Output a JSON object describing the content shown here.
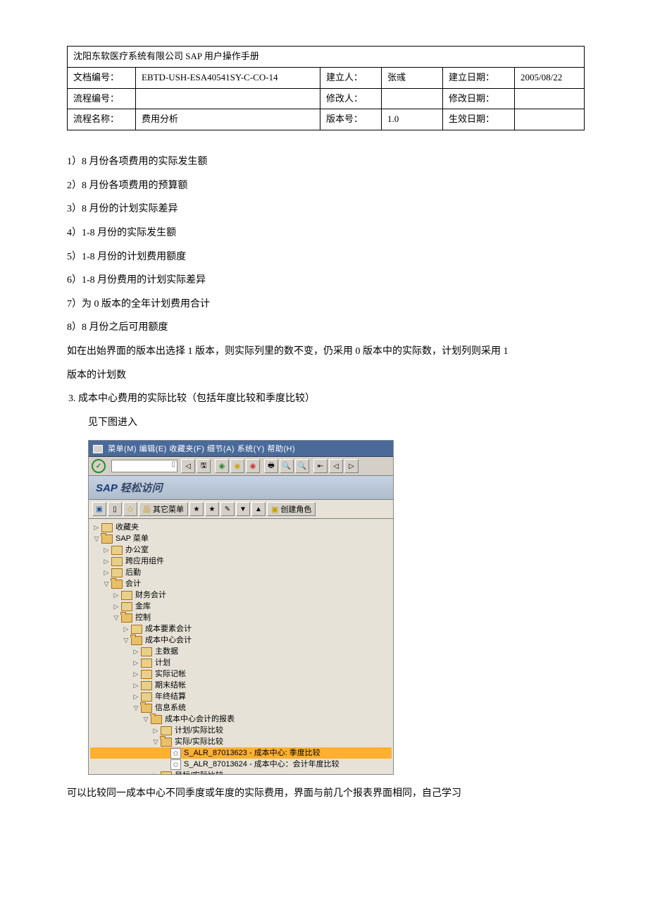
{
  "header": {
    "title": "沈阳东软医疗系统有限公司 SAP 用户操作手册",
    "rows": [
      {
        "c1": "文档编号：",
        "c2": "EBTD-USH-ESA40541SY-C-CO-14",
        "c3": "建立人：",
        "c4": "张彧",
        "c5": "建立日期：",
        "c6": "2005/08/22"
      },
      {
        "c1": "流程编号：",
        "c2": "",
        "c3": "修改人：",
        "c4": "",
        "c5": "修改日期：",
        "c6": ""
      },
      {
        "c1": "流程名称：",
        "c2": "费用分析",
        "c3": "版本号：",
        "c4": "1.0",
        "c5": "生效日期：",
        "c6": ""
      }
    ]
  },
  "lines": {
    "l1": "1）8 月份各项费用的实际发生额",
    "l2": "2）8 月份各项费用的预算额",
    "l3": "3）8 月份的计划实际差异",
    "l4": "4）1-8 月份的实际发生额",
    "l5": "5）1-8 月份的计划费用额度",
    "l6": "6）1-8 月份费用的计划实际差异",
    "l7": "7）为 0 版本的全年计划费用合计",
    "l8": "8）8 月份之后可用额度",
    "l9": "如在出始界面的版本出选择 1 版本，则实际列里的数不变，仍采用 0 版本中的实际数，计划列则采用 1",
    "l10": "版本的计划数",
    "l11": "3.   成本中心费用的实际比较（包括年度比较和季度比较）",
    "l12": "见下图进入",
    "l13": "可以比较同一成本中心不同季度或年度的实际费用，界面与前几个报表界面相同，自己学习"
  },
  "sap": {
    "menubar": "菜单(M)   编辑(E)   收藏夹(F)   细节(A)   系统(Y)   帮助(H)",
    "title": "SAP 轻松访问",
    "toolbar2_label1": "其它菜单",
    "toolbar2_label2": "创建角色",
    "tree": {
      "n0": "收藏夹",
      "n1": "SAP 菜单",
      "n2": "办公室",
      "n3": "跨应用组件",
      "n4": "后勤",
      "n5": "会计",
      "n6": "财务会计",
      "n7": "金库",
      "n8": "控制",
      "n9": "成本要素会计",
      "n10": "成本中心会计",
      "n11": "主数据",
      "n12": "计划",
      "n13": "实际记帐",
      "n14": "期末结帐",
      "n15": "年终结算",
      "n16": "信息系统",
      "n17": "成本中心会计的报表",
      "n18": "计划/实际比较",
      "n19": "实际/实际比较",
      "n20": "S_ALR_87013623 - 成本中心: 季度比较",
      "n21": "S_ALR_87013624 - 成本中心：会计年度比较",
      "n22": "目标/实际比较"
    }
  }
}
